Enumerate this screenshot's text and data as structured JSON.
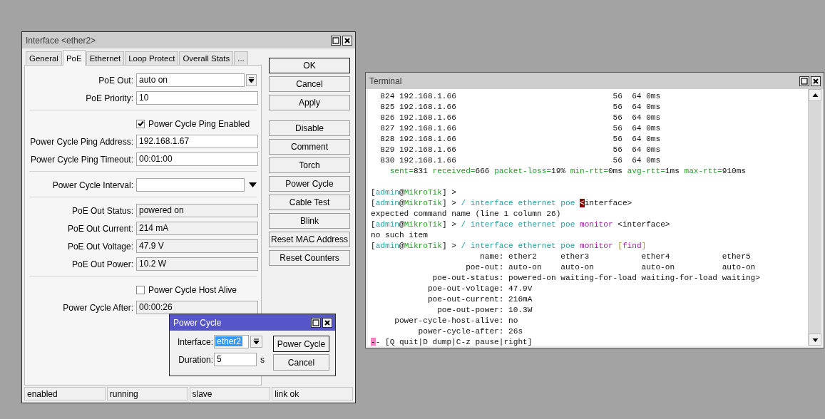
{
  "interface_window": {
    "title": "Interface <ether2>",
    "tabs": [
      {
        "label": "General",
        "selected": false
      },
      {
        "label": "PoE",
        "selected": true
      },
      {
        "label": "Ethernet",
        "selected": false
      },
      {
        "label": "Loop Protect",
        "selected": false
      },
      {
        "label": "Overall Stats",
        "selected": false
      },
      {
        "label": "...",
        "selected": false
      }
    ],
    "fields": [
      {
        "kind": "select",
        "label": "PoE Out:",
        "value": "auto on"
      },
      {
        "kind": "input",
        "label": "PoE Priority:",
        "value": "10"
      },
      {
        "kind": "separator"
      },
      {
        "kind": "checkbox",
        "label": "Power Cycle Ping Enabled",
        "checked": true
      },
      {
        "kind": "input",
        "label": "Power Cycle Ping Address:",
        "value": "192.168.1.67"
      },
      {
        "kind": "input",
        "label": "Power Cycle Ping Timeout:",
        "value": "00:01:00"
      },
      {
        "kind": "separator"
      },
      {
        "kind": "toggle-select",
        "label": "Power Cycle Interval:"
      },
      {
        "kind": "separator"
      },
      {
        "kind": "readonly",
        "label": "PoE Out Status:",
        "value": "powered on"
      },
      {
        "kind": "readonly",
        "label": "PoE Out Current:",
        "value": "214 mA"
      },
      {
        "kind": "readonly",
        "label": "PoE Out Voltage:",
        "value": "47.9 V"
      },
      {
        "kind": "readonly",
        "label": "PoE Out Power:",
        "value": "10.2 W"
      },
      {
        "kind": "separator"
      },
      {
        "kind": "checkbox",
        "label": "Power Cycle Host Alive",
        "checked": false
      },
      {
        "kind": "readonly",
        "label": "Power Cycle After:",
        "value": "00:00:26"
      }
    ],
    "action_buttons": [
      {
        "label": "OK",
        "default": true
      },
      {
        "label": "Cancel",
        "default": false
      },
      {
        "label": "Apply",
        "default": false
      }
    ],
    "command_buttons": [
      "Disable",
      "Comment",
      "Torch",
      "Power Cycle",
      "Cable Test",
      "Blink",
      "Reset MAC Address",
      "Reset Counters"
    ],
    "status_bar": [
      "enabled",
      "running",
      "slave",
      "link ok"
    ]
  },
  "power_cycle_dialog": {
    "title": "Power Cycle",
    "interface": {
      "label": "Interface:",
      "value": "ether2",
      "highlighted": true
    },
    "duration": {
      "label": "Duration:",
      "value": "5",
      "unit": "s"
    },
    "buttons": [
      {
        "label": "Power Cycle",
        "default": true
      },
      {
        "label": "Cancel",
        "default": false
      }
    ]
  },
  "terminal": {
    "title": "Terminal",
    "lines": [
      {
        "segments": [
          {
            "kind": "plain",
            "text": "  824 192.168.1.66                                 56  64 0ms"
          }
        ]
      },
      {
        "segments": [
          {
            "kind": "plain",
            "text": "  825 192.168.1.66                                 56  64 0ms"
          }
        ]
      },
      {
        "segments": [
          {
            "kind": "plain",
            "text": "  826 192.168.1.66                                 56  64 0ms"
          }
        ]
      },
      {
        "segments": [
          {
            "kind": "plain",
            "text": "  827 192.168.1.66                                 56  64 0ms"
          }
        ]
      },
      {
        "segments": [
          {
            "kind": "plain",
            "text": "  828 192.168.1.66                                 56  64 0ms"
          }
        ]
      },
      {
        "segments": [
          {
            "kind": "plain",
            "text": "  829 192.168.1.66                                 56  64 0ms"
          }
        ]
      },
      {
        "segments": [
          {
            "kind": "plain",
            "text": "  830 192.168.1.66                                 56  64 0ms"
          }
        ]
      },
      {
        "segments": [
          {
            "kind": "key",
            "text": "    sent="
          },
          {
            "kind": "plain",
            "text": "831 "
          },
          {
            "kind": "key",
            "text": "received="
          },
          {
            "kind": "plain",
            "text": "666 "
          },
          {
            "kind": "key",
            "text": "packet-loss="
          },
          {
            "kind": "plain",
            "text": "19% "
          },
          {
            "kind": "key",
            "text": "min-rtt="
          },
          {
            "kind": "plain",
            "text": "0ms "
          },
          {
            "kind": "key",
            "text": "avg-rtt="
          },
          {
            "kind": "plain",
            "text": "1ms "
          },
          {
            "kind": "key",
            "text": "max-rtt="
          },
          {
            "kind": "plain",
            "text": "910ms"
          }
        ]
      },
      {
        "blank_before": true,
        "segments": [
          {
            "kind": "plain",
            "text": "["
          },
          {
            "kind": "user",
            "text": "admin"
          },
          {
            "kind": "plain",
            "text": "@"
          },
          {
            "kind": "host",
            "text": "MikroTik"
          },
          {
            "kind": "plain",
            "text": "] >"
          }
        ]
      },
      {
        "segments": [
          {
            "kind": "plain",
            "text": "["
          },
          {
            "kind": "user",
            "text": "admin"
          },
          {
            "kind": "plain",
            "text": "@"
          },
          {
            "kind": "host",
            "text": "MikroTik"
          },
          {
            "kind": "plain",
            "text": "] > "
          },
          {
            "kind": "path",
            "text": "/ interface ethernet poe "
          },
          {
            "kind": "cursor",
            "text": "<"
          },
          {
            "kind": "plain",
            "text": "interface>"
          }
        ]
      },
      {
        "segments": [
          {
            "kind": "plain",
            "text": "expected command name (line 1 column 26)"
          }
        ]
      },
      {
        "segments": [
          {
            "kind": "plain",
            "text": "["
          },
          {
            "kind": "user",
            "text": "admin"
          },
          {
            "kind": "plain",
            "text": "@"
          },
          {
            "kind": "host",
            "text": "MikroTik"
          },
          {
            "kind": "plain",
            "text": "] > "
          },
          {
            "kind": "path",
            "text": "/ interface ethernet poe "
          },
          {
            "kind": "cmd",
            "text": "monitor"
          },
          {
            "kind": "plain",
            "text": " <interface>"
          }
        ]
      },
      {
        "segments": [
          {
            "kind": "plain",
            "text": "no such item"
          }
        ]
      },
      {
        "segments": [
          {
            "kind": "plain",
            "text": "["
          },
          {
            "kind": "user",
            "text": "admin"
          },
          {
            "kind": "plain",
            "text": "@"
          },
          {
            "kind": "host",
            "text": "MikroTik"
          },
          {
            "kind": "plain",
            "text": "] > "
          },
          {
            "kind": "path",
            "text": "/ interface ethernet poe "
          },
          {
            "kind": "cmd",
            "text": "monitor "
          },
          {
            "kind": "arg",
            "text": "["
          },
          {
            "kind": "cmd",
            "text": "find"
          },
          {
            "kind": "arg",
            "text": "]"
          }
        ]
      },
      {
        "segments": [
          {
            "kind": "plain",
            "text": "                       name: ether2     ether3           ether4           ether5"
          }
        ]
      },
      {
        "segments": [
          {
            "kind": "plain",
            "text": "                    poe-out: auto-on    auto-on          auto-on          auto-on"
          }
        ]
      },
      {
        "segments": [
          {
            "kind": "plain",
            "text": "             poe-out-status: powered-on waiting-for-load waiting-for-load waiting>"
          }
        ]
      },
      {
        "segments": [
          {
            "kind": "plain",
            "text": "            poe-out-voltage: 47.9V"
          }
        ]
      },
      {
        "segments": [
          {
            "kind": "plain",
            "text": "            poe-out-current: 216mA"
          }
        ]
      },
      {
        "segments": [
          {
            "kind": "plain",
            "text": "              poe-out-power: 10.3W"
          }
        ]
      },
      {
        "segments": [
          {
            "kind": "plain",
            "text": "     power-cycle-host-alive: no"
          }
        ]
      },
      {
        "segments": [
          {
            "kind": "plain",
            "text": "          power-cycle-after: 26s"
          }
        ]
      },
      {
        "segments": [
          {
            "kind": "pager",
            "text": "-"
          },
          {
            "kind": "plain",
            "text": "- [Q quit|D dump|C-z pause|right]"
          }
        ]
      }
    ]
  }
}
